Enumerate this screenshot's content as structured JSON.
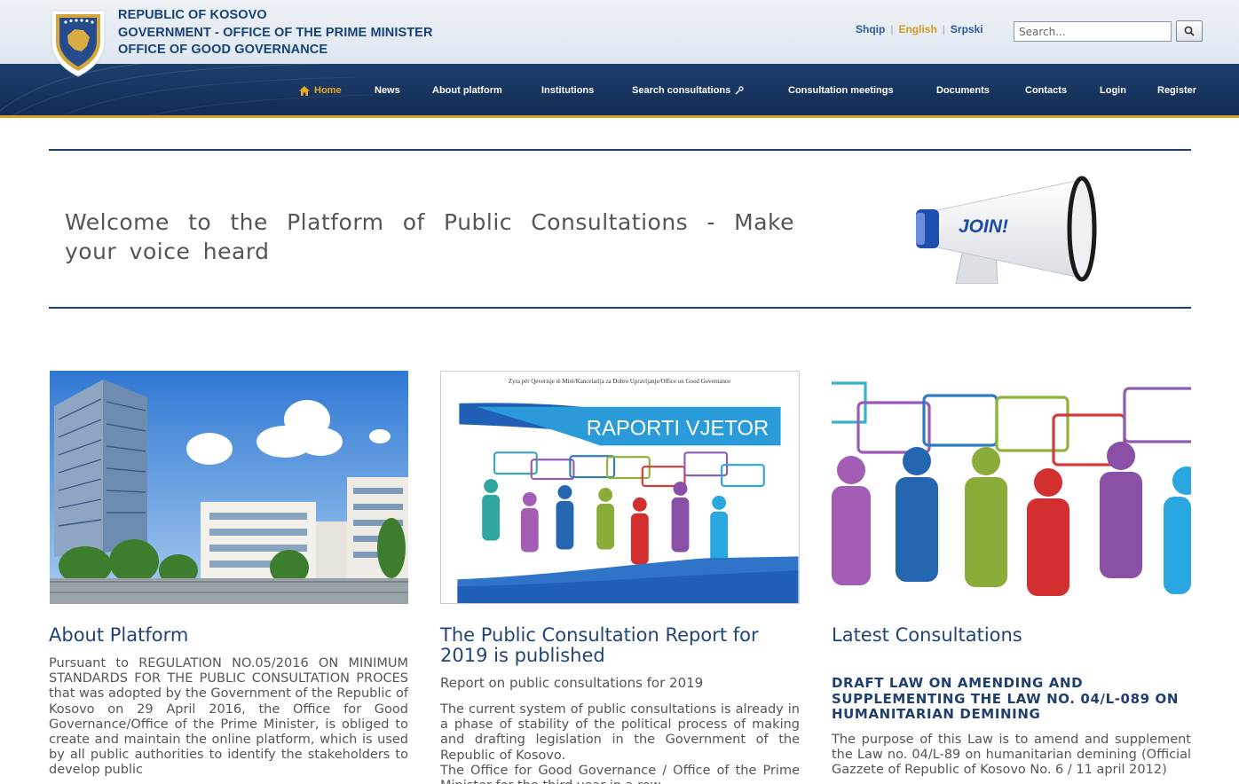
{
  "header": {
    "org_lines": [
      "REPUBLIC OF KOSOVO",
      "GOVERNMENT - OFFICE OF THE PRIME MINISTER",
      "OFFICE OF GOOD GOVERNANCE"
    ],
    "languages": [
      "Shqip",
      "English",
      "Srpski"
    ],
    "active_language": "English",
    "search_placeholder": "Search..."
  },
  "nav": {
    "items": [
      "Home",
      "News",
      "About platform",
      "Institutions",
      "Search consultations",
      "Consultation meetings",
      "Documents",
      "Contacts",
      "Login",
      "Register"
    ],
    "active": "Home"
  },
  "banner": {
    "welcome": "Welcome to the Platform of Public Consultations - Make your voice heard",
    "join_label": "JOIN!"
  },
  "cards": {
    "about": {
      "title": "About Platform",
      "text": "Pursuant to REGULATION NO.05/2016 ON MINIMUM STANDARDS FOR THE PUBLIC CONSULTATION PROCES that was adopted by the Government of the Republic of Kosovo on 29 April 2016, the Office for Good Governance/Office of the Prime Minister, is obliged to create and maintain the online platform, which is used by all public authorities to identify the stakeholders to develop public"
    },
    "report": {
      "image_header": "Zyra për Qeverisje të Mirë/Kancelarija za Dobro Upravljanje/Office on Good Governance",
      "image_title": "RAPORTI VJETOR",
      "title": "The Public Consultation Report for 2019 is published",
      "subtitle": "Report on public consultations for 2019",
      "text_1": "The current system of public consultations is already in a phase of stability of the political process of making and drafting legislation in the Government of the Republic of Kosovo.",
      "text_2": "The Office for Good Governance / Office of the Prime Minister for the third year in a row"
    },
    "latest": {
      "title": "Latest Consultations",
      "item_title": "DRAFT LAW ON AMENDING AND SUPPLEMENTING THE LAW NO. 04/L-089 ON HUMANITARIAN DEMINING",
      "item_text": "The purpose of this Law is to amend and supplement the Law no. 04/L-89 on humanitarian demining (Official Gazzete of Republic of Kosovo No. 6 / 11 april 2012)"
    }
  },
  "icons": {
    "home": "home-icon",
    "search": "search-icon",
    "external": "external-link-icon"
  },
  "colors": {
    "brand_navy": "#16427a",
    "nav_bg": "#1d3f6e",
    "accent_gold": "#d7a227",
    "active_lang": "#d49a1c",
    "title_blue": "#1e4478"
  }
}
